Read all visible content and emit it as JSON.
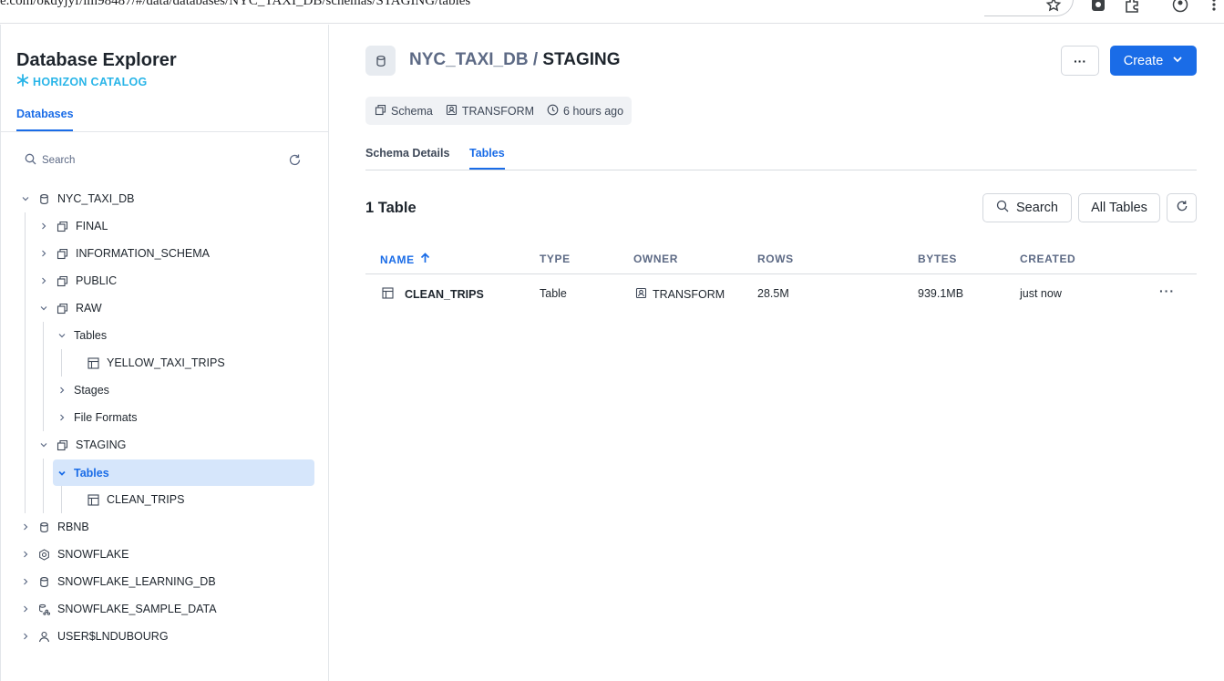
{
  "browser": {
    "url": "e.com/okdyjyf/lm98487/#/data/databases/NYC_TAXI_DB/schemas/STAGING/tables",
    "icons": [
      "star-icon",
      "extension-icon",
      "puzzle-icon",
      "profile-icon",
      "kebab-icon"
    ]
  },
  "sidebar": {
    "title": "Database Explorer",
    "subtitle": "HORIZON CATALOG",
    "tab": "Databases",
    "search_placeholder": "Search",
    "tree": [
      {
        "label": "NYC_TAXI_DB",
        "icon": "database-icon",
        "expanded": true
      },
      {
        "label": "FINAL",
        "icon": "schema-icon",
        "expanded": false
      },
      {
        "label": "INFORMATION_SCHEMA",
        "icon": "schema-icon",
        "expanded": false
      },
      {
        "label": "PUBLIC",
        "icon": "schema-icon",
        "expanded": false
      },
      {
        "label": "RAW",
        "icon": "schema-icon",
        "expanded": true
      },
      {
        "label": "Tables",
        "icon": "",
        "expanded": true
      },
      {
        "label": "YELLOW_TAXI_TRIPS",
        "icon": "table-icon"
      },
      {
        "label": "Stages",
        "icon": "",
        "expanded": false
      },
      {
        "label": "File Formats",
        "icon": "",
        "expanded": false
      },
      {
        "label": "STAGING",
        "icon": "schema-icon",
        "expanded": true
      },
      {
        "label": "Tables",
        "icon": "",
        "expanded": true,
        "selected": true
      },
      {
        "label": "CLEAN_TRIPS",
        "icon": "table-icon"
      },
      {
        "label": "RBNB",
        "icon": "database-icon",
        "expanded": false
      },
      {
        "label": "SNOWFLAKE",
        "icon": "shared-database-icon",
        "expanded": false
      },
      {
        "label": "SNOWFLAKE_LEARNING_DB",
        "icon": "database-icon",
        "expanded": false
      },
      {
        "label": "SNOWFLAKE_SAMPLE_DATA",
        "icon": "shared-data-icon",
        "expanded": false
      },
      {
        "label": "USER$LNDUBOURG",
        "icon": "user-icon",
        "expanded": false
      }
    ]
  },
  "header": {
    "database": "NYC_TAXI_DB",
    "separator": " / ",
    "schema": "STAGING",
    "more_label": "···",
    "create_label": "Create"
  },
  "meta": {
    "type": "Schema",
    "owner": "TRANSFORM",
    "modified": "6 hours ago"
  },
  "tabs": [
    {
      "label": "Schema Details",
      "active": false
    },
    {
      "label": "Tables",
      "active": true
    }
  ],
  "table_count": "1 Table",
  "toolbar": {
    "search_label": "Search",
    "filter_label": "All Tables"
  },
  "table": {
    "columns": [
      "NAME",
      "TYPE",
      "OWNER",
      "ROWS",
      "BYTES",
      "CREATED"
    ],
    "sort_column": "NAME",
    "rows": [
      {
        "name": "CLEAN_TRIPS",
        "type": "Table",
        "owner": "TRANSFORM",
        "rows": "28.5M",
        "bytes": "939.1MB",
        "created": "just now",
        "actions": "···"
      }
    ]
  },
  "colors": {
    "accent": "#1a6ce7",
    "brand": "#29b5e8",
    "selected_bg": "#d6e6fb"
  }
}
